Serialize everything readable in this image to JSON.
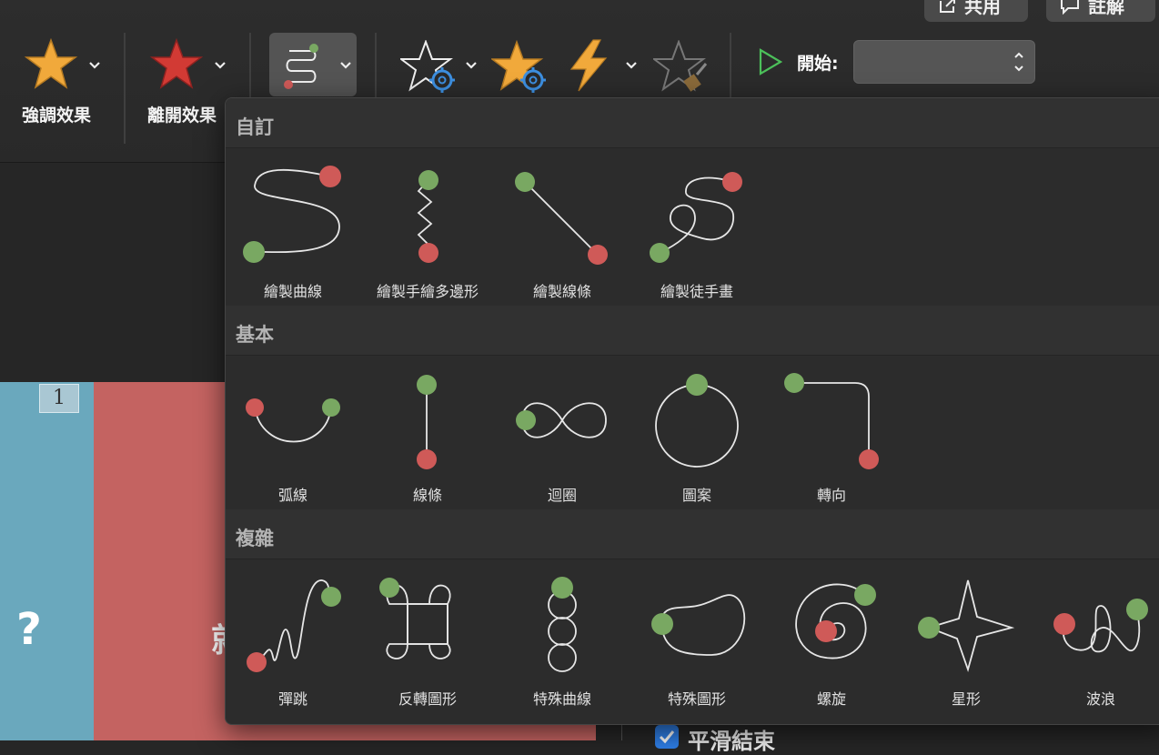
{
  "toolbar": {
    "share_label": "共用",
    "comments_label": "註解",
    "emphasis_label": "強調效果",
    "exit_label": "離開效果",
    "start_label": "開始:",
    "start_value": ""
  },
  "slide": {
    "number": "1",
    "question_mark": "?",
    "partial_char": "就"
  },
  "options": {
    "smooth_end_label": "平滑結束"
  },
  "panel": {
    "sections": [
      {
        "title": "自訂",
        "items": [
          {
            "label": "繪製曲線"
          },
          {
            "label": "繪製手繪多邊形"
          },
          {
            "label": "繪製線條"
          },
          {
            "label": "繪製徒手畫"
          }
        ]
      },
      {
        "title": "基本",
        "items": [
          {
            "label": "弧線"
          },
          {
            "label": "線條"
          },
          {
            "label": "迴圈"
          },
          {
            "label": "圖案"
          },
          {
            "label": "轉向"
          }
        ]
      },
      {
        "title": "複雜",
        "items": [
          {
            "label": "彈跳"
          },
          {
            "label": "反轉圖形"
          },
          {
            "label": "特殊曲線"
          },
          {
            "label": "特殊圖形"
          },
          {
            "label": "螺旋"
          },
          {
            "label": "星形"
          },
          {
            "label": "波浪"
          }
        ]
      }
    ]
  },
  "colors": {
    "start_point": "#79a862",
    "end_point": "#cf5a58",
    "star_gold": "#f1a93b",
    "star_red": "#d23a34",
    "gear_blue": "#3d8fe0"
  }
}
